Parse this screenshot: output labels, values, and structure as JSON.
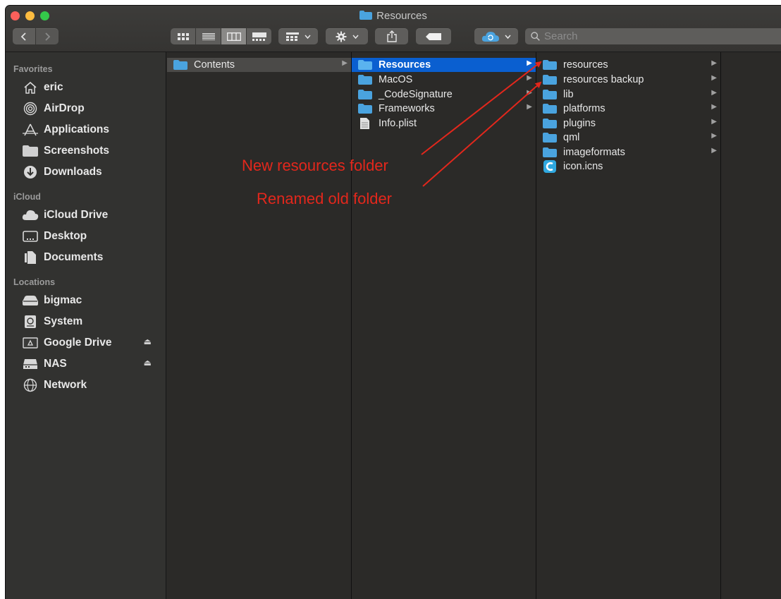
{
  "window": {
    "title": "Resources"
  },
  "toolbar": {
    "search_placeholder": "Search"
  },
  "sidebar": {
    "sections": [
      {
        "heading": "Favorites",
        "items": [
          {
            "label": "eric",
            "icon": "home-icon"
          },
          {
            "label": "AirDrop",
            "icon": "airdrop-icon"
          },
          {
            "label": "Applications",
            "icon": "applications-icon"
          },
          {
            "label": "Screenshots",
            "icon": "folder-icon"
          },
          {
            "label": "Downloads",
            "icon": "downloads-icon"
          }
        ]
      },
      {
        "heading": "iCloud",
        "items": [
          {
            "label": "iCloud Drive",
            "icon": "cloud-icon"
          },
          {
            "label": "Desktop",
            "icon": "desktop-icon"
          },
          {
            "label": "Documents",
            "icon": "documents-icon"
          }
        ]
      },
      {
        "heading": "Locations",
        "items": [
          {
            "label": "bigmac",
            "icon": "disk-icon"
          },
          {
            "label": "System",
            "icon": "system-disk-icon"
          },
          {
            "label": "Google Drive",
            "icon": "google-drive-icon"
          },
          {
            "label": "NAS",
            "icon": "nas-icon"
          },
          {
            "label": "Network",
            "icon": "network-icon"
          }
        ]
      }
    ]
  },
  "columns": [
    {
      "items": [
        {
          "label": "Contents",
          "type": "folder"
        }
      ]
    },
    {
      "items": [
        {
          "label": "Resources",
          "type": "folder"
        },
        {
          "label": "MacOS",
          "type": "folder"
        },
        {
          "label": "_CodeSignature",
          "type": "folder"
        },
        {
          "label": "Frameworks",
          "type": "folder"
        },
        {
          "label": "Info.plist",
          "type": "file"
        }
      ]
    },
    {
      "items": [
        {
          "label": "resources",
          "type": "folder"
        },
        {
          "label": "resources backup",
          "type": "folder"
        },
        {
          "label": "lib",
          "type": "folder"
        },
        {
          "label": "platforms",
          "type": "folder"
        },
        {
          "label": "plugins",
          "type": "folder"
        },
        {
          "label": "qml",
          "type": "folder"
        },
        {
          "label": "imageformats",
          "type": "folder"
        },
        {
          "label": "icon.icns",
          "type": "icns"
        }
      ]
    }
  ],
  "annotations": {
    "new_folder": "New resources folder",
    "renamed": "Renamed old folder"
  },
  "colors": {
    "selection": "#0a5fd0",
    "folder": "#4aa3df",
    "annotation": "#e3271c"
  }
}
